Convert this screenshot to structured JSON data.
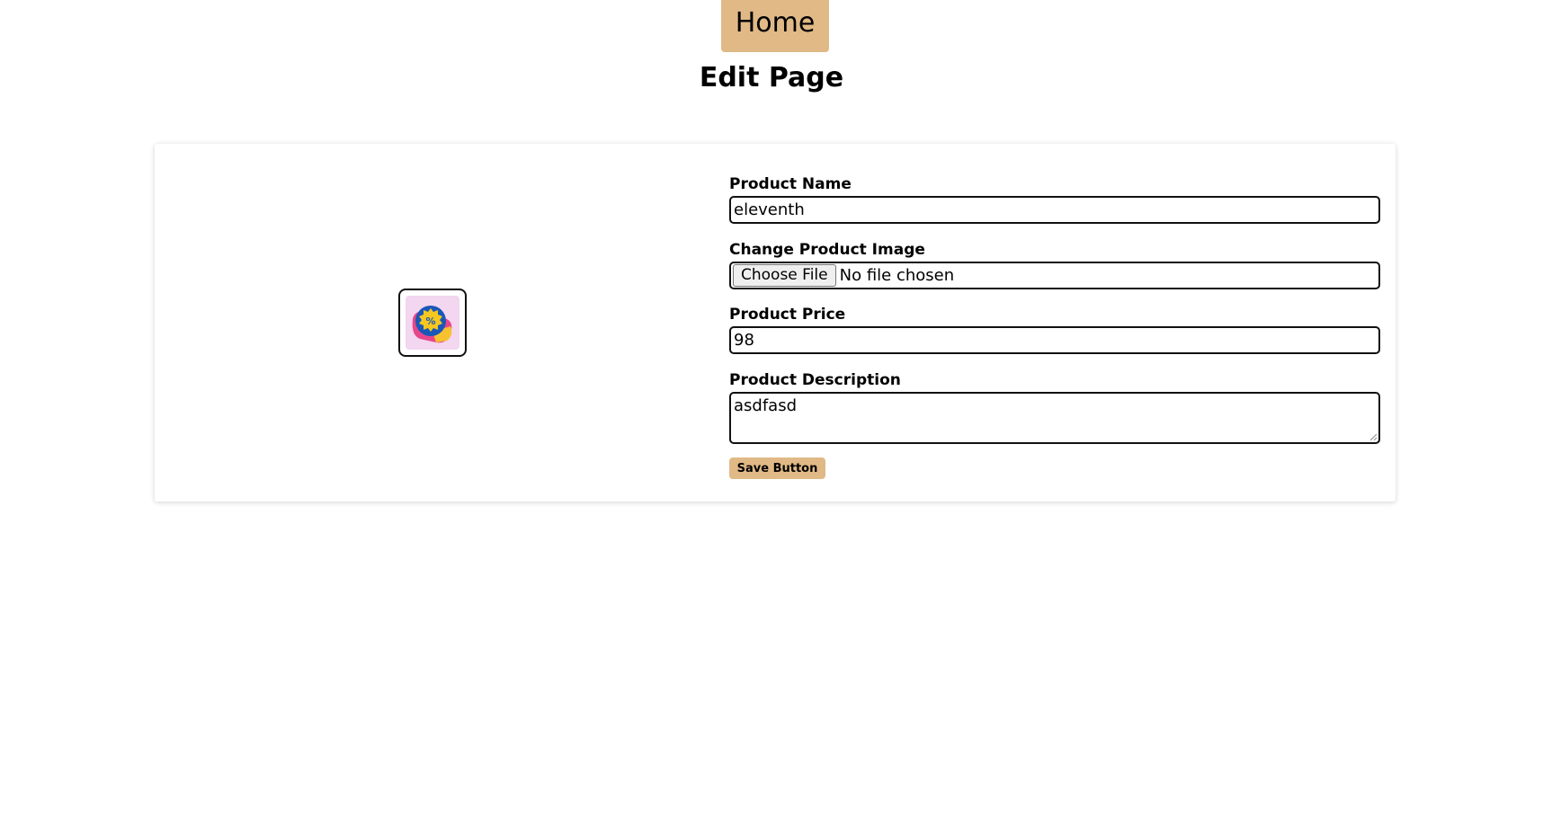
{
  "nav": {
    "home_label": "Home"
  },
  "page": {
    "title": "Edit Page"
  },
  "product_image": {
    "icon": "discount-tag-icon",
    "colors": {
      "background": "#f3d6ef",
      "pink": "#e8468a",
      "yellow": "#f6c230",
      "blue": "#1a57b8",
      "badge": "#f5c71f"
    }
  },
  "form": {
    "name_label": "Product Name",
    "name_value": "eleventh",
    "image_label": "Change Product Image",
    "choose_file_label": "Choose File",
    "file_status": "No file chosen",
    "price_label": "Product Price",
    "price_value": "98",
    "description_label": "Product Description",
    "description_value": "asdfasd",
    "save_label": "Save Button"
  },
  "colors": {
    "accent": "#e0b986"
  }
}
